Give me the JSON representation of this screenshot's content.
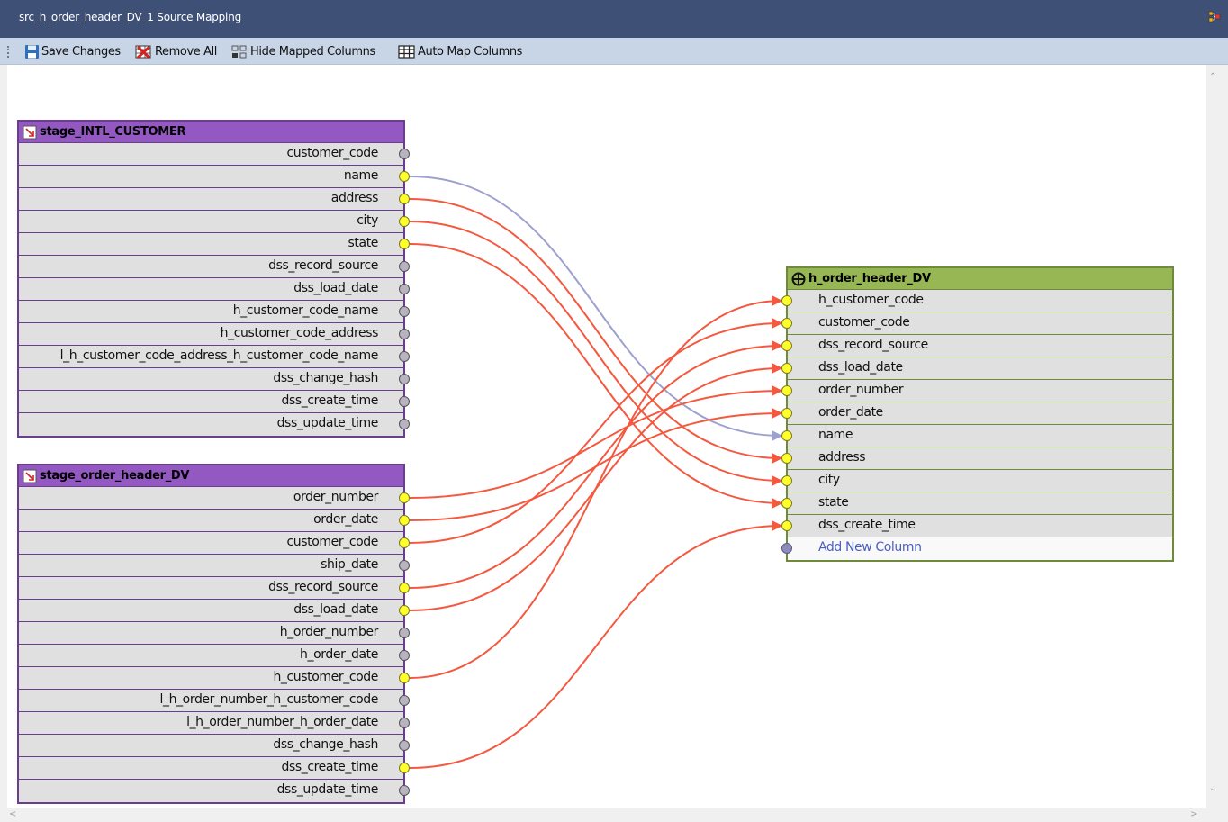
{
  "window": {
    "title": "src_h_order_header_DV_1 Source Mapping",
    "icon": "diagram-icon"
  },
  "toolbar": {
    "save_label": "Save Changes",
    "remove_label": "Remove All",
    "hide_label": "Hide Mapped Columns",
    "auto_label": "Auto Map Columns"
  },
  "colors": {
    "title_bar": "#3e5076",
    "toolbar": "#c8d5e6",
    "source_header": "#9358c2",
    "target_header": "#96b753",
    "link": "#f4583f",
    "link_passthrough": "#9ea0cf",
    "mapped_port": "#ffff2c"
  },
  "source_tables": [
    {
      "name": "stage_INTL_CUSTOMER",
      "columns": [
        {
          "name": "customer_code",
          "mapped": false
        },
        {
          "name": "name",
          "mapped": true
        },
        {
          "name": "address",
          "mapped": true
        },
        {
          "name": "city",
          "mapped": true
        },
        {
          "name": "state",
          "mapped": true
        },
        {
          "name": "dss_record_source",
          "mapped": false
        },
        {
          "name": "dss_load_date",
          "mapped": false
        },
        {
          "name": "h_customer_code_name",
          "mapped": false
        },
        {
          "name": "h_customer_code_address",
          "mapped": false
        },
        {
          "name": "l_h_customer_code_address_h_customer_code_name",
          "mapped": false
        },
        {
          "name": "dss_change_hash",
          "mapped": false
        },
        {
          "name": "dss_create_time",
          "mapped": false
        },
        {
          "name": "dss_update_time",
          "mapped": false
        }
      ]
    },
    {
      "name": "stage_order_header_DV",
      "columns": [
        {
          "name": "order_number",
          "mapped": true
        },
        {
          "name": "order_date",
          "mapped": true
        },
        {
          "name": "customer_code",
          "mapped": true
        },
        {
          "name": "ship_date",
          "mapped": false
        },
        {
          "name": "dss_record_source",
          "mapped": true
        },
        {
          "name": "dss_load_date",
          "mapped": true
        },
        {
          "name": "h_order_number",
          "mapped": false
        },
        {
          "name": "h_order_date",
          "mapped": false
        },
        {
          "name": "h_customer_code",
          "mapped": true
        },
        {
          "name": "l_h_order_number_h_customer_code",
          "mapped": false
        },
        {
          "name": "l_h_order_number_h_order_date",
          "mapped": false
        },
        {
          "name": "dss_change_hash",
          "mapped": false
        },
        {
          "name": "dss_create_time",
          "mapped": true
        },
        {
          "name": "dss_update_time",
          "mapped": false
        }
      ]
    }
  ],
  "target_table": {
    "name": "h_order_header_DV",
    "columns": [
      {
        "name": "h_customer_code"
      },
      {
        "name": "customer_code"
      },
      {
        "name": "dss_record_source"
      },
      {
        "name": "dss_load_date"
      },
      {
        "name": "order_number"
      },
      {
        "name": "order_date"
      },
      {
        "name": "name"
      },
      {
        "name": "address"
      },
      {
        "name": "city"
      },
      {
        "name": "state"
      },
      {
        "name": "dss_create_time"
      }
    ],
    "add_new_label": "Add New Column"
  },
  "mappings": [
    {
      "source_table": 0,
      "source_col": 1,
      "target_col": 6,
      "style": "passthrough"
    },
    {
      "source_table": 0,
      "source_col": 2,
      "target_col": 7,
      "style": "link"
    },
    {
      "source_table": 0,
      "source_col": 3,
      "target_col": 8,
      "style": "link"
    },
    {
      "source_table": 0,
      "source_col": 4,
      "target_col": 9,
      "style": "link"
    },
    {
      "source_table": 1,
      "source_col": 0,
      "target_col": 4,
      "style": "link"
    },
    {
      "source_table": 1,
      "source_col": 1,
      "target_col": 5,
      "style": "link"
    },
    {
      "source_table": 1,
      "source_col": 2,
      "target_col": 1,
      "style": "link"
    },
    {
      "source_table": 1,
      "source_col": 4,
      "target_col": 2,
      "style": "link"
    },
    {
      "source_table": 1,
      "source_col": 5,
      "target_col": 3,
      "style": "link"
    },
    {
      "source_table": 1,
      "source_col": 8,
      "target_col": 0,
      "style": "link"
    },
    {
      "source_table": 1,
      "source_col": 12,
      "target_col": 10,
      "style": "link"
    }
  ]
}
